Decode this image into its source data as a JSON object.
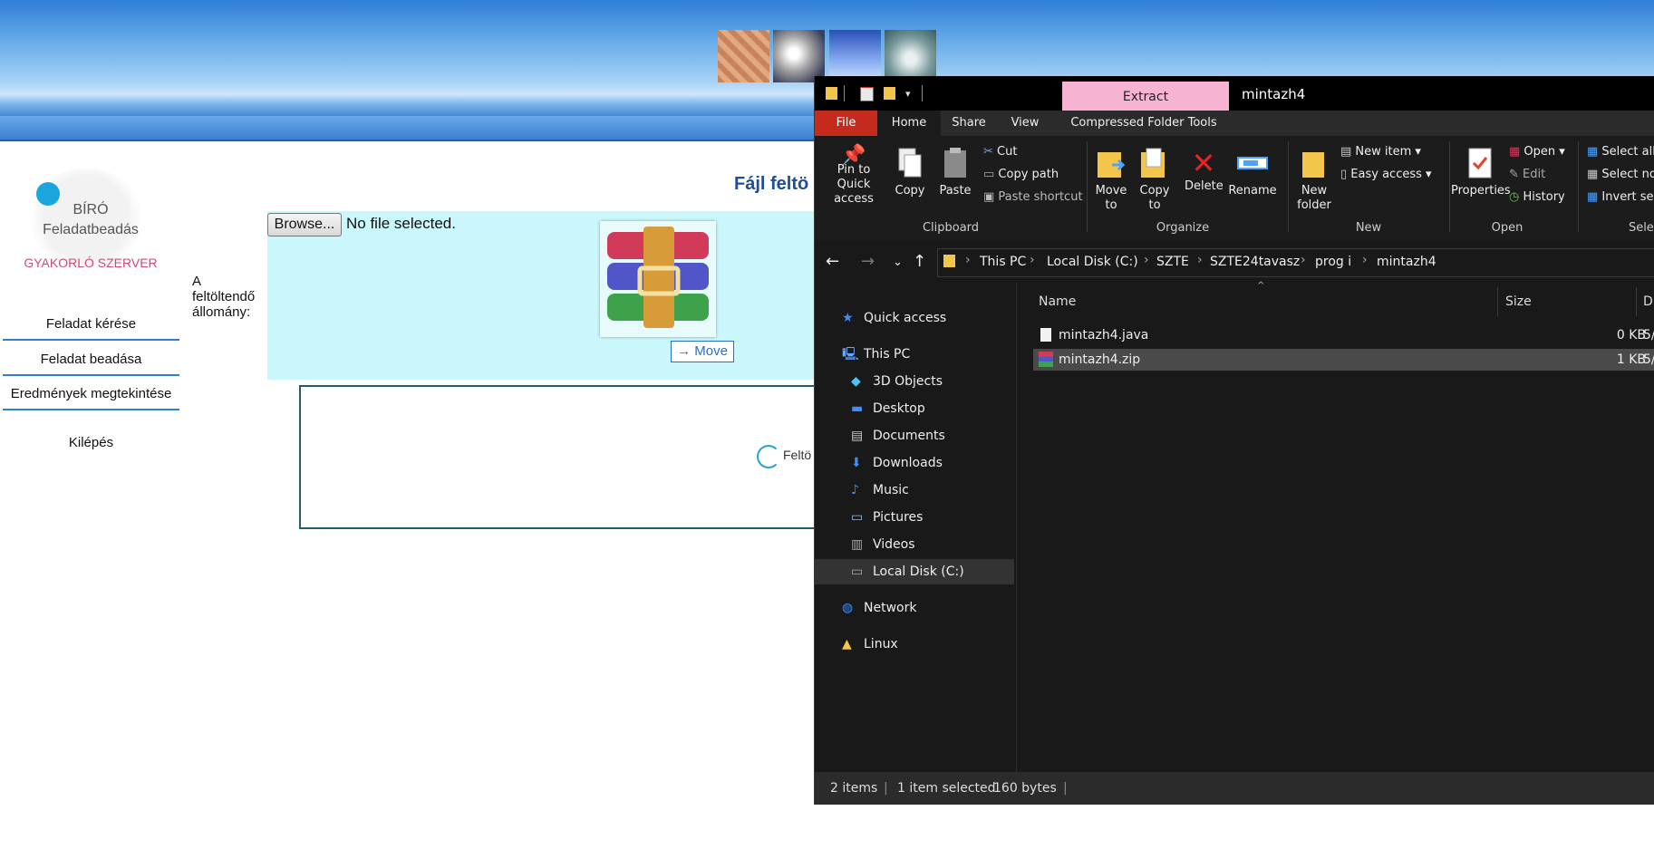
{
  "webpage": {
    "logo": {
      "line1": "BÍRÓ",
      "line2": "Feladatbeadás",
      "line3": "GYAKORLÓ SZERVER"
    },
    "nav": [
      {
        "label": "Feladat kérése"
      },
      {
        "label": "Feladat beadása"
      },
      {
        "label": "Eredmények megtekintése"
      },
      {
        "label": "Kilépés"
      }
    ],
    "heading": "Fájl feltö",
    "upload_label": "A feltöltendő állomány:",
    "browse_label": "Browse...",
    "file_status": "No file selected.",
    "drag_tooltip": "Move",
    "drag_tooltip_icon": "arrow-right-icon",
    "spinner_text": "Feltö"
  },
  "explorer": {
    "title": "mintazh4",
    "context_tab": "Extract",
    "tabs": [
      "File",
      "Home",
      "Share",
      "View",
      "Compressed Folder Tools"
    ],
    "ribbon": {
      "clipboard": {
        "group": "Clipboard",
        "pin": "Pin to Quick access",
        "copy": "Copy",
        "paste": "Paste",
        "cut": "Cut",
        "copy_path": "Copy path",
        "paste_shortcut": "Paste shortcut"
      },
      "organize": {
        "group": "Organize",
        "move_to": "Move to",
        "copy_to": "Copy to",
        "delete": "Delete",
        "rename": "Rename"
      },
      "new": {
        "group": "New",
        "new_folder": "New folder",
        "new_item": "New item",
        "easy_access": "Easy access"
      },
      "open": {
        "group": "Open",
        "properties": "Properties",
        "open": "Open",
        "edit": "Edit",
        "history": "History"
      },
      "select": {
        "group": "Select",
        "select_all": "Select all",
        "select_none": "Select no",
        "invert": "Invert sel"
      }
    },
    "breadcrumb": [
      "This PC",
      "Local Disk (C:)",
      "SZTE",
      "SZTE24tavasz",
      "prog i",
      "mintazh4"
    ],
    "nav_pane": [
      {
        "label": "Quick access",
        "icon": "star-icon"
      },
      {
        "label": "This PC",
        "icon": "computer-icon"
      },
      {
        "label": "3D Objects",
        "icon": "cube-icon"
      },
      {
        "label": "Desktop",
        "icon": "desktop-icon"
      },
      {
        "label": "Documents",
        "icon": "document-icon"
      },
      {
        "label": "Downloads",
        "icon": "download-icon"
      },
      {
        "label": "Music",
        "icon": "music-icon"
      },
      {
        "label": "Pictures",
        "icon": "picture-icon"
      },
      {
        "label": "Videos",
        "icon": "video-icon"
      },
      {
        "label": "Local Disk (C:)",
        "icon": "drive-icon"
      },
      {
        "label": "Network",
        "icon": "network-icon"
      },
      {
        "label": "Linux",
        "icon": "linux-icon"
      }
    ],
    "columns": {
      "name": "Name",
      "size": "Size",
      "date": "D"
    },
    "files": [
      {
        "name": "mintazh4.java",
        "size": "0 KB",
        "date": "5/"
      },
      {
        "name": "mintazh4.zip",
        "size": "1 KB",
        "date": "5/"
      }
    ],
    "status": {
      "items": "2 items",
      "selected": "1 item selected",
      "bytes": "160 bytes"
    }
  }
}
